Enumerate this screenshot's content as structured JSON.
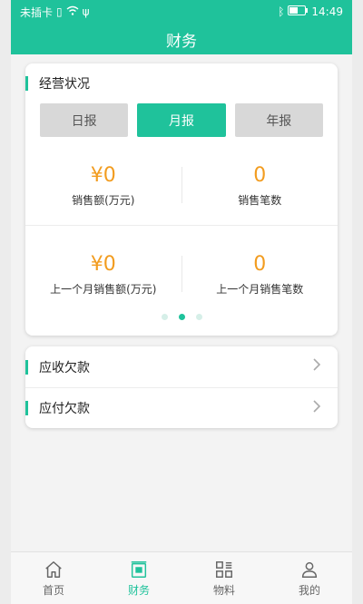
{
  "statusbar": {
    "carrier": "未插卡",
    "time": "14:49"
  },
  "header": {
    "title": "财务"
  },
  "business": {
    "title": "经营状况",
    "tabs": [
      {
        "label": "日报",
        "active": false
      },
      {
        "label": "月报",
        "active": true
      },
      {
        "label": "年报",
        "active": false
      }
    ],
    "metrics": [
      {
        "value": "¥0",
        "label": "销售额(万元)"
      },
      {
        "value": "0",
        "label": "销售笔数"
      },
      {
        "value": "¥0",
        "label": "上一个月销售额(万元)"
      },
      {
        "value": "0",
        "label": "上一个月销售笔数"
      }
    ],
    "pager": {
      "count": 3,
      "active": 1
    }
  },
  "debts": [
    {
      "label": "应收欠款"
    },
    {
      "label": "应付欠款"
    }
  ],
  "tabbar": [
    {
      "label": "首页",
      "icon": "home-icon",
      "active": false
    },
    {
      "label": "财务",
      "icon": "finance-icon",
      "active": true
    },
    {
      "label": "物料",
      "icon": "grid-icon",
      "active": false
    },
    {
      "label": "我的",
      "icon": "user-icon",
      "active": false
    }
  ],
  "colors": {
    "accent": "#1fc29b",
    "value": "#f29c1f"
  }
}
